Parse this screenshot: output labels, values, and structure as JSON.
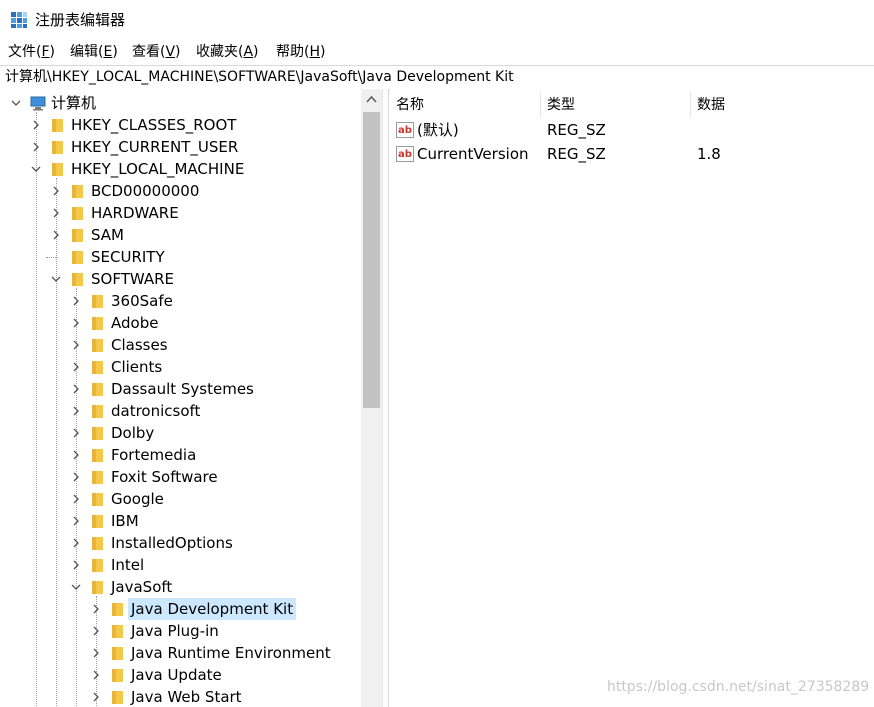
{
  "window": {
    "title": "注册表编辑器"
  },
  "menu": [
    {
      "label": "文件",
      "accel": "F"
    },
    {
      "label": "编辑",
      "accel": "E"
    },
    {
      "label": "查看",
      "accel": "V"
    },
    {
      "label": "收藏夹",
      "accel": "A"
    },
    {
      "label": "帮助",
      "accel": "H"
    }
  ],
  "address": {
    "path": "计算机\\HKEY_LOCAL_MACHINE\\SOFTWARE\\JavaSoft\\Java Development Kit"
  },
  "tree": [
    {
      "label": "计算机",
      "level": 0,
      "state": "expanded",
      "icon": "computer-icon"
    },
    {
      "label": "HKEY_CLASSES_ROOT",
      "level": 1,
      "state": "collapsed"
    },
    {
      "label": "HKEY_CURRENT_USER",
      "level": 1,
      "state": "collapsed"
    },
    {
      "label": "HKEY_LOCAL_MACHINE",
      "level": 1,
      "state": "expanded"
    },
    {
      "label": "BCD00000000",
      "level": 2,
      "state": "collapsed"
    },
    {
      "label": "HARDWARE",
      "level": 2,
      "state": "collapsed"
    },
    {
      "label": "SAM",
      "level": 2,
      "state": "collapsed"
    },
    {
      "label": "SECURITY",
      "level": 2,
      "state": "leaf"
    },
    {
      "label": "SOFTWARE",
      "level": 2,
      "state": "expanded"
    },
    {
      "label": "360Safe",
      "level": 3,
      "state": "collapsed"
    },
    {
      "label": "Adobe",
      "level": 3,
      "state": "collapsed"
    },
    {
      "label": "Classes",
      "level": 3,
      "state": "collapsed"
    },
    {
      "label": "Clients",
      "level": 3,
      "state": "collapsed"
    },
    {
      "label": "Dassault Systemes",
      "level": 3,
      "state": "collapsed"
    },
    {
      "label": "datronicsoft",
      "level": 3,
      "state": "collapsed"
    },
    {
      "label": "Dolby",
      "level": 3,
      "state": "collapsed"
    },
    {
      "label": "Fortemedia",
      "level": 3,
      "state": "collapsed"
    },
    {
      "label": "Foxit Software",
      "level": 3,
      "state": "collapsed"
    },
    {
      "label": "Google",
      "level": 3,
      "state": "collapsed"
    },
    {
      "label": "IBM",
      "level": 3,
      "state": "collapsed"
    },
    {
      "label": "InstalledOptions",
      "level": 3,
      "state": "collapsed"
    },
    {
      "label": "Intel",
      "level": 3,
      "state": "collapsed"
    },
    {
      "label": "JavaSoft",
      "level": 3,
      "state": "expanded"
    },
    {
      "label": "Java Development Kit",
      "level": 4,
      "state": "collapsed",
      "selected": true
    },
    {
      "label": "Java Plug-in",
      "level": 4,
      "state": "collapsed"
    },
    {
      "label": "Java Runtime Environment",
      "level": 4,
      "state": "collapsed"
    },
    {
      "label": "Java Update",
      "level": 4,
      "state": "collapsed"
    },
    {
      "label": "Java Web Start",
      "level": 4,
      "state": "collapsed"
    }
  ],
  "list": {
    "columns": [
      "名称",
      "类型",
      "数据"
    ],
    "rows": [
      {
        "name": "(默认)",
        "type": "REG_SZ",
        "data": ""
      },
      {
        "name": "CurrentVersion",
        "type": "REG_SZ",
        "data": "1.8"
      }
    ]
  },
  "watermark": "https://blog.csdn.net/sinat_27358289",
  "colors": {
    "selection": "#cce8ff",
    "folder": "#f4c94a",
    "ab_icon": "#c8372d",
    "scroll_thumb": "#c2c2c2"
  }
}
